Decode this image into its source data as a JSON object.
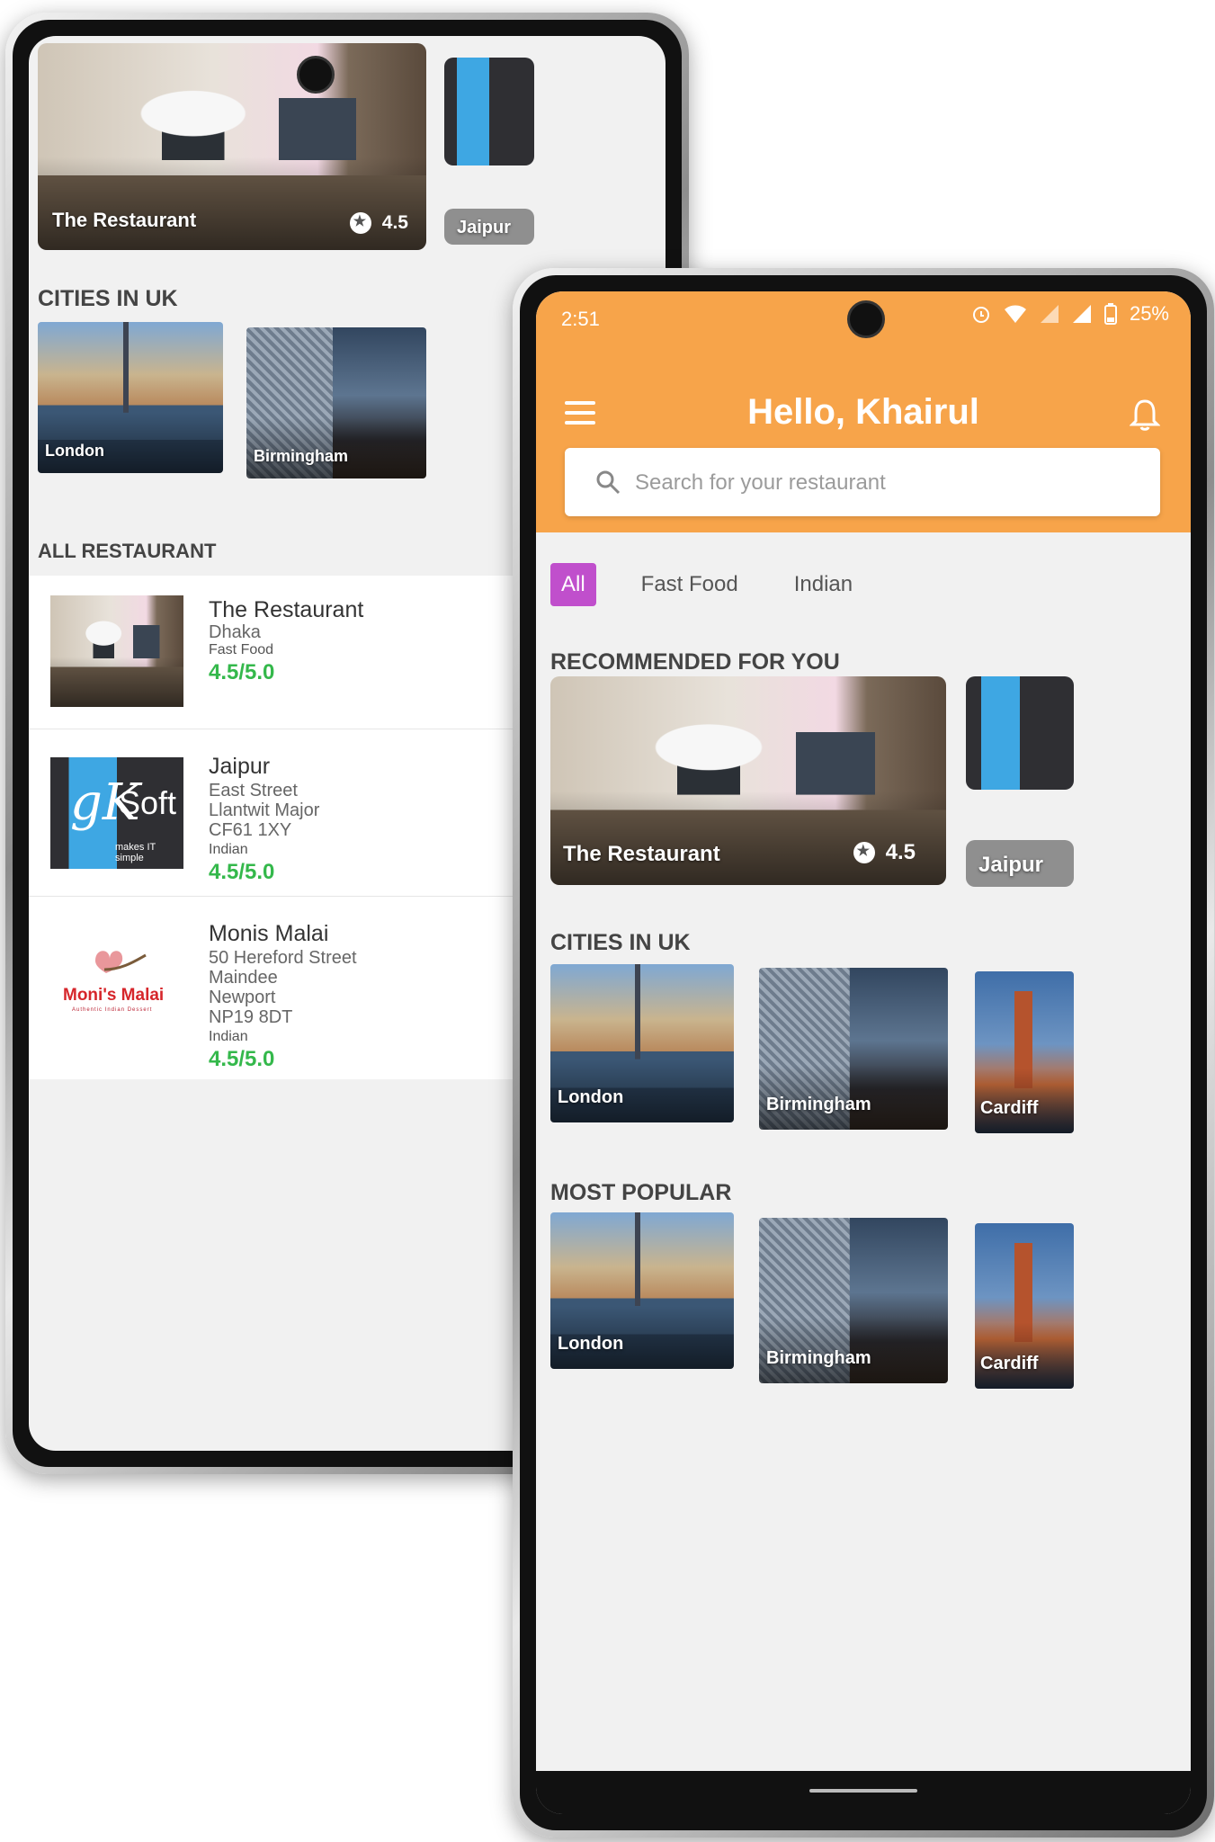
{
  "back_screen": {
    "hero": {
      "name": "The Restaurant",
      "rating": "4.5",
      "side_label": "Jaipur"
    },
    "cities_title": "CITIES IN UK",
    "cities": [
      "London",
      "Birmingham"
    ],
    "all_title": "ALL RESTAURANT",
    "restaurants": [
      {
        "name": "The Restaurant",
        "address": [
          "Dhaka"
        ],
        "category": "Fast Food",
        "rating": "4.5/5.0"
      },
      {
        "name": "Jaipur",
        "address": [
          "East Street",
          "Llantwit Major",
          "CF61 1XY"
        ],
        "category": "Indian",
        "rating": "4.5/5.0"
      },
      {
        "name": "Monis Malai",
        "address": [
          "50 Hereford Street",
          "Maindee",
          "Newport",
          "NP19 8DT"
        ],
        "category": "Indian",
        "rating": "4.5/5.0"
      }
    ],
    "logo_text": {
      "gk": "gK",
      "soft": "Soft",
      "tagline": "makes IT simple",
      "monis": "Moni's Malai",
      "monis_sub": "Authentic Indian Dessert"
    }
  },
  "front_screen": {
    "status": {
      "time": "2:51",
      "battery": "25%"
    },
    "greeting": "Hello, Khairul",
    "search": {
      "placeholder": "Search for your restaurant"
    },
    "filters": [
      "All",
      "Fast Food",
      "Indian"
    ],
    "recommended_title": "RECOMMENDED FOR YOU",
    "recommended": [
      {
        "name": "The Restaurant",
        "rating": "4.5"
      },
      {
        "name": "Jaipur"
      }
    ],
    "cities_title": "CITIES IN UK",
    "cities": [
      "London",
      "Birmingham",
      "Cardiff"
    ],
    "popular_title": "MOST POPULAR",
    "popular": [
      "London",
      "Birmingham",
      "Cardiff"
    ]
  },
  "colors": {
    "header": "#f7a44a",
    "chip_active": "#c04fcc",
    "rating_green": "#34b84b"
  }
}
